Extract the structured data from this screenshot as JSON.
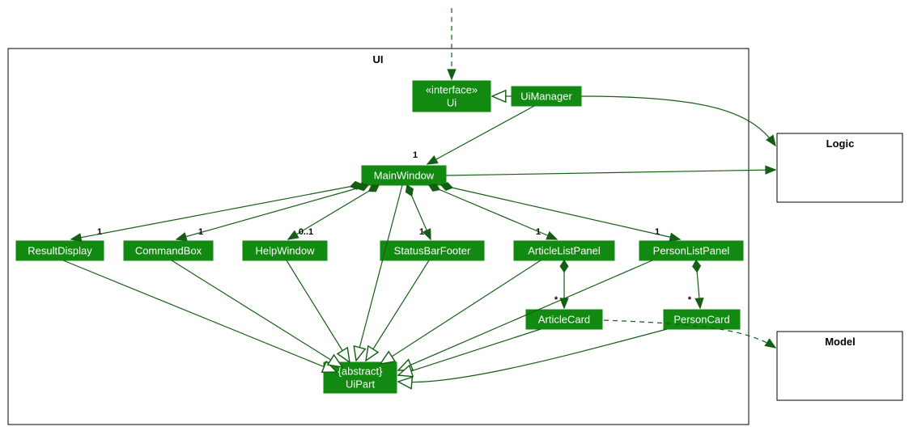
{
  "package": {
    "label": "UI"
  },
  "external": {
    "logic": "Logic",
    "model": "Model"
  },
  "nodes": {
    "ui_iface": {
      "stereo": "«interface»",
      "name": "Ui"
    },
    "uimanager": "UiManager",
    "mainwindow": "MainWindow",
    "resultdisplay": "ResultDisplay",
    "commandbox": "CommandBox",
    "helpwindow": "HelpWindow",
    "statusbar": "StatusBarFooter",
    "articlelist": "ArticleListPanel",
    "personlist": "PersonListPanel",
    "articlecard": "ArticleCard",
    "personcard": "PersonCard",
    "uipart": {
      "stereo": "{abstract}",
      "name": "UiPart"
    }
  },
  "mult": {
    "mw": "1",
    "rd": "1",
    "cb": "1",
    "hw": "0..1",
    "sb": "1",
    "al": "1",
    "pl": "1",
    "ac": "*",
    "pc": "*"
  }
}
